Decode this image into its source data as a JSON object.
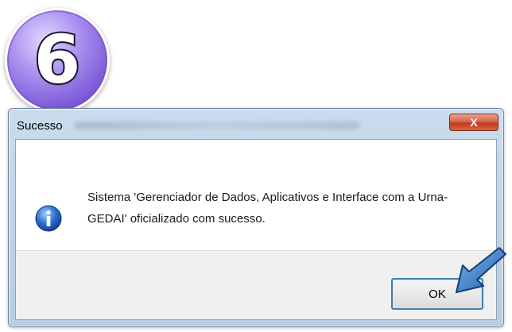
{
  "step": {
    "number": "6",
    "color": "#7a57d6"
  },
  "dialog": {
    "title": "Sucesso",
    "close_label": "X",
    "message": "Sistema 'Gerenciador de Dados, Aplicativos e Interface com a Urna-GEDAI' oficializado com sucesso.",
    "icon": "info-icon",
    "ok_label": "OK"
  },
  "colors": {
    "close_button": "#c4391b",
    "ok_border": "#3c7fb1",
    "pointer_arrow": "#2f6fb5"
  }
}
